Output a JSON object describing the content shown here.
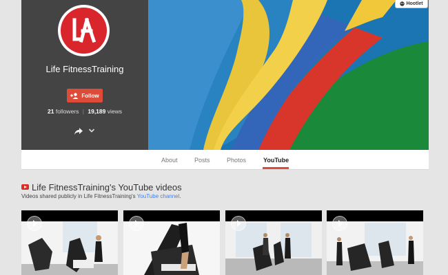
{
  "profile": {
    "name": "Life FitnessTraining",
    "follow_label": "Follow",
    "followers_count": "21",
    "followers_label": "followers",
    "views_count": "19,189",
    "views_label": "views",
    "logo_icon": "life-fitness-logo",
    "brand_color": "#d9252c"
  },
  "cover": {
    "badge_label": "Hootlet"
  },
  "tabs": [
    {
      "label": "About"
    },
    {
      "label": "Posts"
    },
    {
      "label": "Photos"
    },
    {
      "label": "YouTube",
      "active": true
    }
  ],
  "videos_section": {
    "title": "Life FitnessTraining's YouTube videos",
    "subtitle_prefix": "Videos shared publicly in Life FitnessTraining's ",
    "subtitle_link": "YouTube channel",
    "subtitle_suffix": ".",
    "link_color": "#427fed"
  },
  "accent_color": "#dd4b39"
}
